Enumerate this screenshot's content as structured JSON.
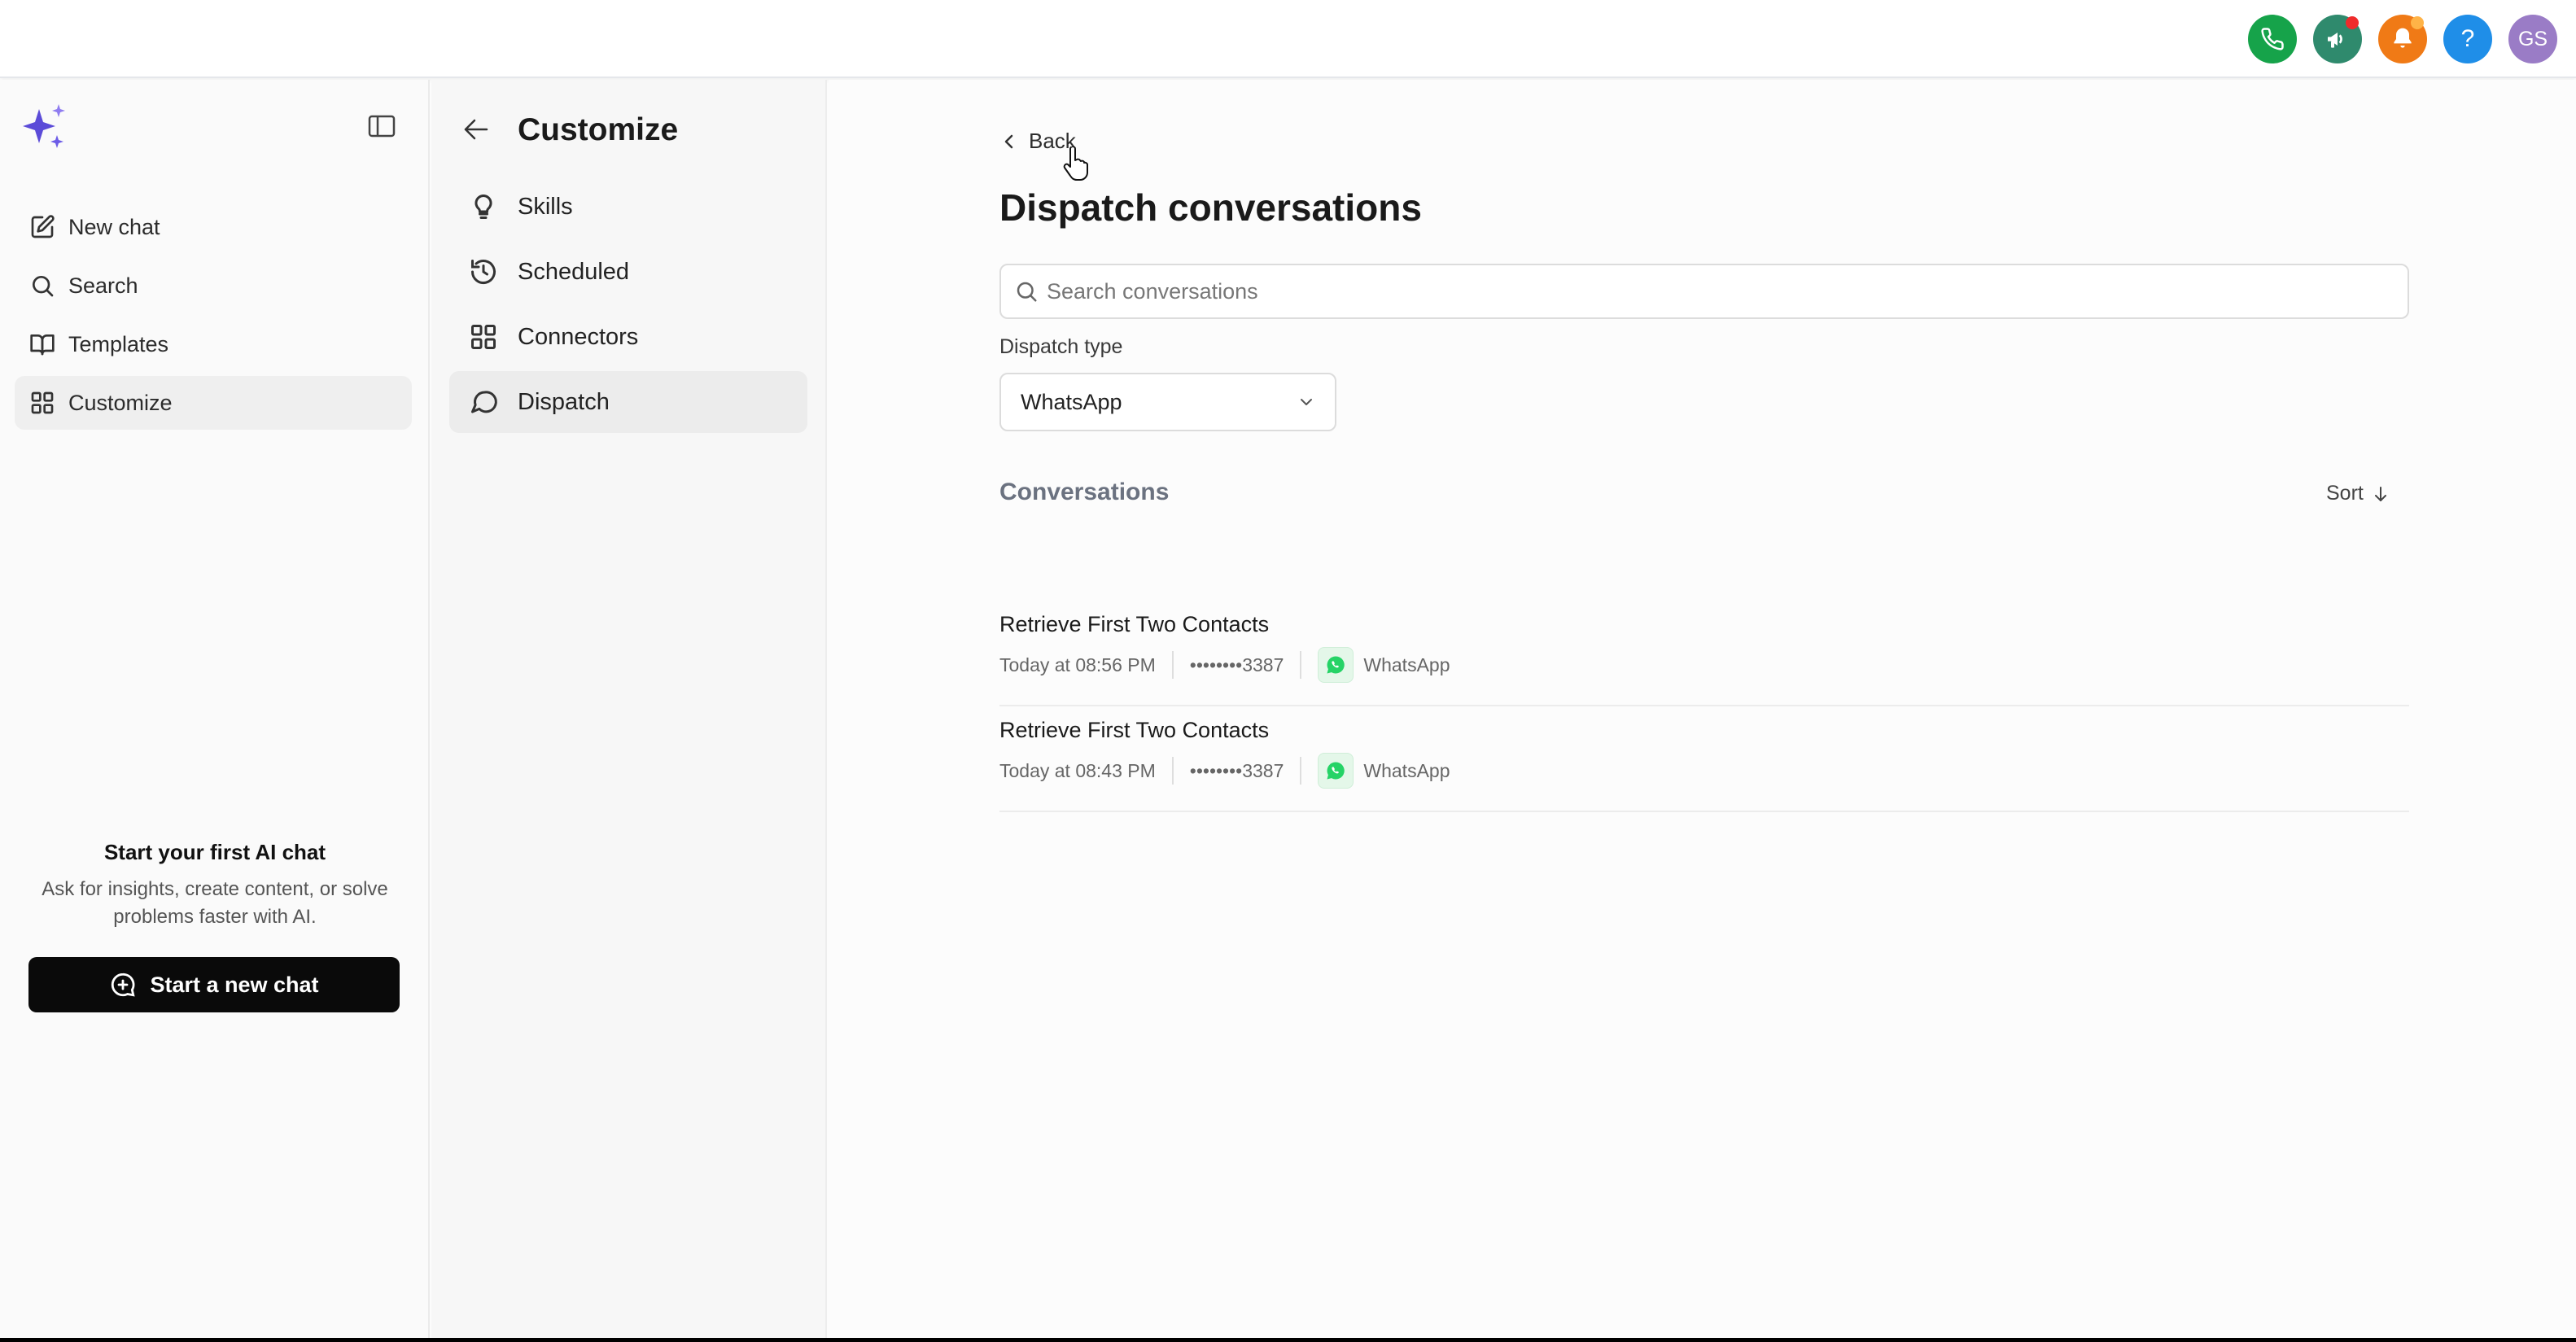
{
  "topbar": {
    "icons": [
      "phone-icon",
      "megaphone-icon",
      "bell-icon",
      "help-icon"
    ],
    "help_label": "?",
    "avatar_initials": "GS",
    "colors": {
      "phone": "#16a34a",
      "announcements": "#2f8a6d",
      "notifications": "#f07a16",
      "help": "#1f8ee8",
      "avatar": "#9a7cc6",
      "badge_red": "#ef2b2b",
      "badge_orange": "#ffb347"
    }
  },
  "sidebar": {
    "logo": "sparkle-logo",
    "items": [
      {
        "label": "New chat",
        "icon": "edit-icon"
      },
      {
        "label": "Search",
        "icon": "search-icon"
      },
      {
        "label": "Templates",
        "icon": "book-icon"
      },
      {
        "label": "Customize",
        "icon": "grid-icon",
        "active": true
      }
    ],
    "promo_title": "Start your first AI chat",
    "promo_text": "Ask for insights, create content, or solve problems faster with AI.",
    "start_button": "Start a new chat"
  },
  "customize": {
    "title": "Customize",
    "items": [
      {
        "label": "Skills",
        "icon": "lightbulb-icon"
      },
      {
        "label": "Scheduled",
        "icon": "history-icon"
      },
      {
        "label": "Connectors",
        "icon": "grid-icon"
      },
      {
        "label": "Dispatch",
        "icon": "chat-bubble-icon",
        "active": true
      }
    ]
  },
  "main": {
    "back_label": "Back",
    "title": "Dispatch conversations",
    "search_placeholder": "Search conversations",
    "dispatch_type_label": "Dispatch type",
    "dispatch_type_value": "WhatsApp",
    "conversations_heading": "Conversations",
    "sort_label": "Sort",
    "conversations": [
      {
        "title": "Retrieve First Two Contacts",
        "time": "Today at 08:56 PM",
        "number": "••••••••3387",
        "channel": "WhatsApp"
      },
      {
        "title": "Retrieve First Two Contacts",
        "time": "Today at 08:43 PM",
        "number": "••••••••3387",
        "channel": "WhatsApp"
      }
    ],
    "whatsapp_color": "#25d366"
  }
}
